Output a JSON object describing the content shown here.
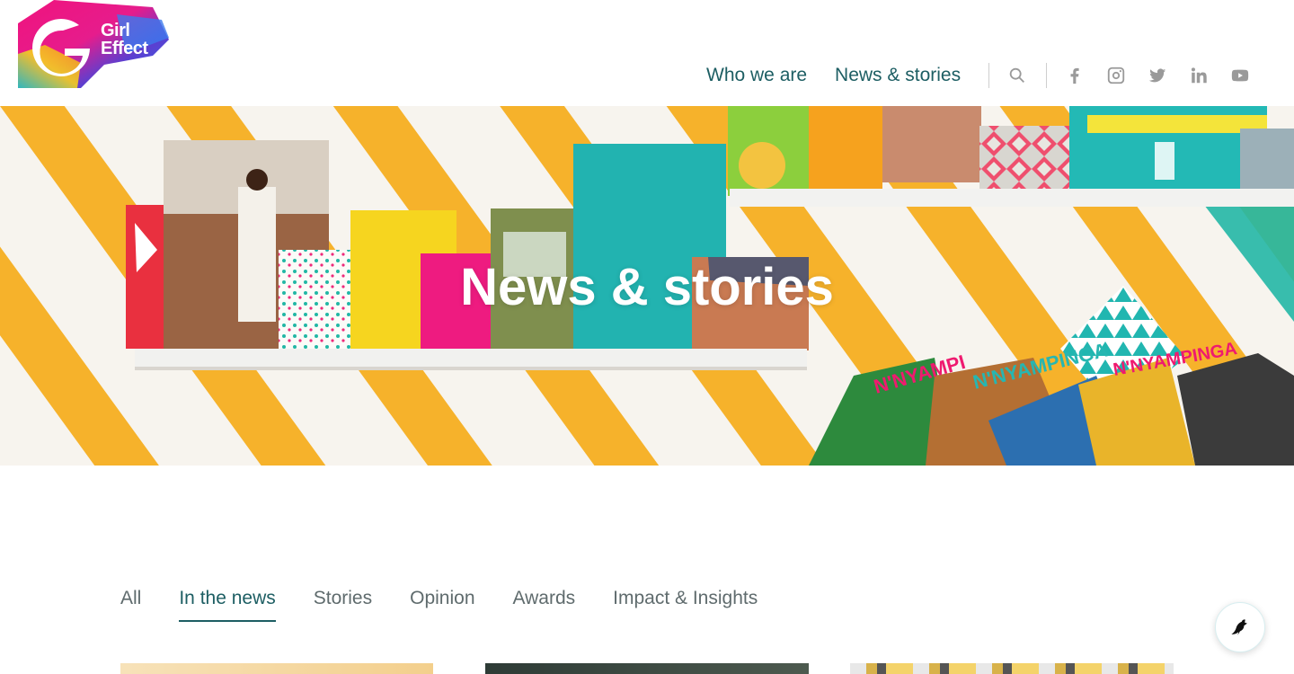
{
  "brand": {
    "name_line1": "Girl",
    "name_line2": "Effect"
  },
  "nav": {
    "links": [
      {
        "label": "Who we are"
      },
      {
        "label": "News & stories"
      }
    ],
    "icons": [
      "search-icon",
      "facebook-icon",
      "instagram-icon",
      "twitter-icon",
      "linkedin-icon",
      "youtube-icon"
    ]
  },
  "hero": {
    "title": "News & stories"
  },
  "tabs": [
    {
      "label": "All",
      "active": false
    },
    {
      "label": "In the news",
      "active": true
    },
    {
      "label": "Stories",
      "active": false
    },
    {
      "label": "Opinion",
      "active": false
    },
    {
      "label": "Awards",
      "active": false
    },
    {
      "label": "Impact & Insights",
      "active": false
    }
  ],
  "colors": {
    "accent": "#1d5e63",
    "stripe_orange": "#f6b22b",
    "stripe_teal": "#22b7a5"
  }
}
